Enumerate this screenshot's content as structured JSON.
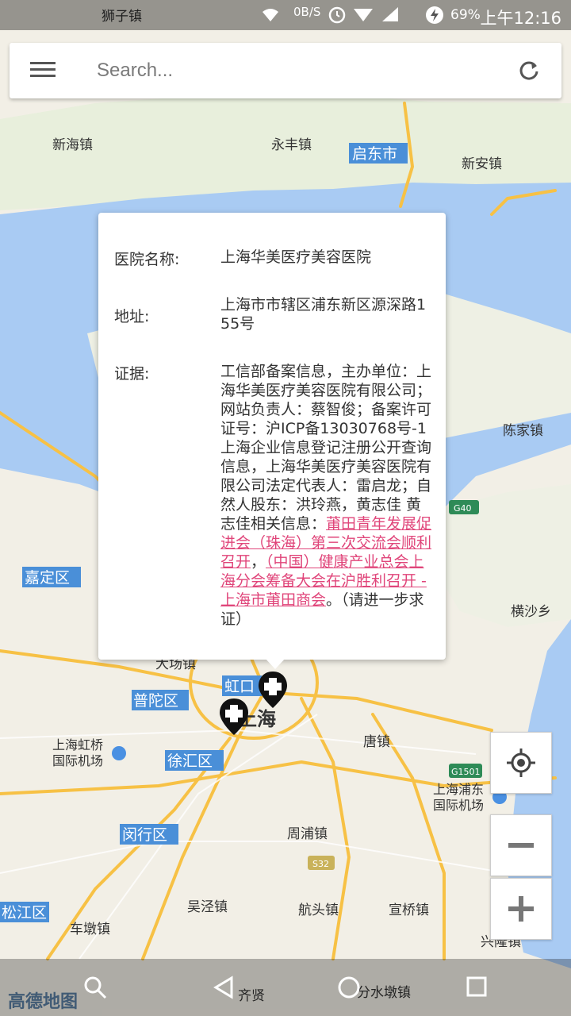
{
  "status_bar": {
    "network_speed": "0B/S",
    "battery_percent": "69%",
    "time": "上午12:16"
  },
  "search": {
    "placeholder": "Search..."
  },
  "map": {
    "labels": [
      {
        "id": "shizi",
        "text": "狮子镇"
      },
      {
        "id": "xinhai",
        "text": "新海镇"
      },
      {
        "id": "yongfeng",
        "text": "永丰镇"
      },
      {
        "id": "xinan",
        "text": "新安镇"
      },
      {
        "id": "chenjia",
        "text": "陈家镇"
      },
      {
        "id": "hengsha",
        "text": "横沙乡"
      },
      {
        "id": "dachang",
        "text": "大场镇"
      },
      {
        "id": "hongqiao",
        "text": "上海虹桥\n国际机场"
      },
      {
        "id": "tang",
        "text": "唐镇"
      },
      {
        "id": "pudong_airport",
        "text": "上海浦东\n国际机场"
      },
      {
        "id": "zhoupu",
        "text": "周浦镇"
      },
      {
        "id": "wujing",
        "text": "吴泾镇"
      },
      {
        "id": "hangtou",
        "text": "航头镇"
      },
      {
        "id": "xuanqiao",
        "text": "宣桥镇"
      },
      {
        "id": "chedun",
        "text": "车墩镇"
      },
      {
        "id": "xinchang",
        "text": "兴隆镇"
      },
      {
        "id": "qixian",
        "text": "齐贤"
      },
      {
        "id": "fenshuidun",
        "text": "分水墩镇"
      },
      {
        "id": "shanghai",
        "text": "上海"
      }
    ],
    "district_labels": [
      {
        "id": "qidong",
        "text": "启东市"
      },
      {
        "id": "jiading",
        "text": "嘉定区"
      },
      {
        "id": "putuo",
        "text": "普陀区"
      },
      {
        "id": "hongkou",
        "text": "虹口"
      },
      {
        "id": "xuhui",
        "text": "徐汇区"
      },
      {
        "id": "minhang",
        "text": "闵行区"
      },
      {
        "id": "songjiang",
        "text": "松江区"
      }
    ],
    "road_shields": [
      {
        "id": "g40",
        "text": "G40"
      },
      {
        "id": "g1501",
        "text": "G1501"
      },
      {
        "id": "s32",
        "text": "S32"
      }
    ],
    "watermark": "高德地图"
  },
  "popup": {
    "name_label": "医院名称:",
    "name_value": "上海华美医疗美容医院",
    "address_label": "地址:",
    "address_value": "上海市市辖区浦东新区源深路155号",
    "evidence_label": "证据:",
    "evidence_text_1": "工信部备案信息，主办单位：上海华美医疗美容医院有限公司；网站负责人：蔡智俊；备案许可证号：沪ICP备13030768号-1 上海企业信息登记注册公开查询信息，上海华美医疗美容医院有限公司法定代表人：雷启龙；自然人股东：洪玲燕，黄志佳 黄志佳相关信息：",
    "evidence_link_1": "莆田青年发展促进会（珠海）第三次交流会顺利召开",
    "evidence_sep": "，",
    "evidence_link_2": "（中国）健康产业总会上海分会筹备大会在沪胜利召开 - 上海市莆田商会",
    "evidence_text_2": "。（请进一步求证）"
  }
}
